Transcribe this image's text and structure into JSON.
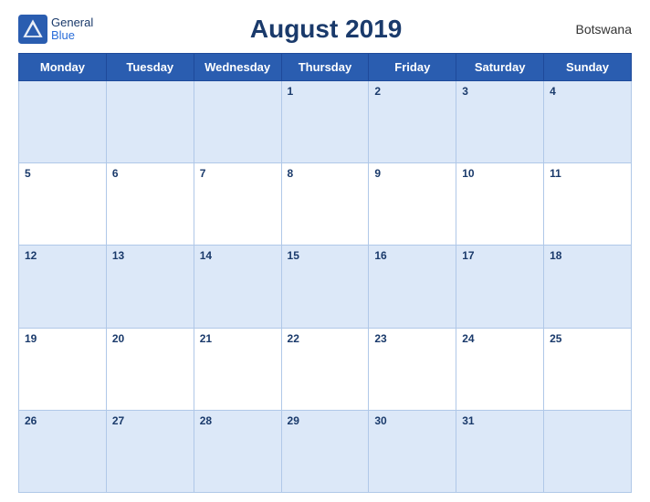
{
  "header": {
    "logo_line1": "General",
    "logo_line2": "Blue",
    "title": "August 2019",
    "country": "Botswana"
  },
  "days_of_week": [
    "Monday",
    "Tuesday",
    "Wednesday",
    "Thursday",
    "Friday",
    "Saturday",
    "Sunday"
  ],
  "weeks": [
    [
      null,
      null,
      null,
      1,
      2,
      3,
      4
    ],
    [
      5,
      6,
      7,
      8,
      9,
      10,
      11
    ],
    [
      12,
      13,
      14,
      15,
      16,
      17,
      18
    ],
    [
      19,
      20,
      21,
      22,
      23,
      24,
      25
    ],
    [
      26,
      27,
      28,
      29,
      30,
      31,
      null
    ]
  ]
}
